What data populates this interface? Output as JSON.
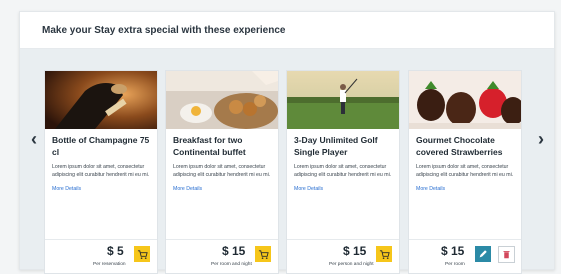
{
  "section": {
    "title": "Make your Stay extra special with these experience"
  },
  "nav": {
    "prev_icon": "‹",
    "next_icon": "›"
  },
  "cards": [
    {
      "title": "Bottle of Champagne 75 cl",
      "description": "Lorem ipsum dolor sit amet, consectetur adipiscing elit curabitur hendrerit mi eu mi.",
      "more": "More Details",
      "price": "$ 5",
      "price_note": "Per reservation",
      "action": "cart-icon"
    },
    {
      "title": "Breakfast for two Continental buffet",
      "description": "Lorem ipsum dolor sit amet, consectetur adipiscing elit curabitur hendrerit mi eu mi.",
      "more": "More Details",
      "price": "$ 15",
      "price_note": "Per room and night",
      "action": "cart-icon"
    },
    {
      "title": "3-Day Unlimited Golf Single Player",
      "description": "Lorem ipsum dolor sit amet, consectetur adipiscing elit curabitur hendrerit mi eu mi.",
      "more": "More Details",
      "price": "$ 15",
      "price_note": "Per person and night",
      "action": "cart-icon"
    },
    {
      "title": "Gourmet Chocolate covered Strawberries",
      "description": "Lorem ipsum dolor sit amet, consectetur adipiscing elit curabitur hendrerit mi eu mi.",
      "more": "More Details",
      "price": "$ 15",
      "price_note": "Per room",
      "action": "edit-delete"
    }
  ],
  "colors": {
    "accent_yellow": "#f6c61a",
    "edit_teal": "#2b8aa6",
    "link_blue": "#2a6fd1",
    "delete_red": "#d2475b"
  }
}
